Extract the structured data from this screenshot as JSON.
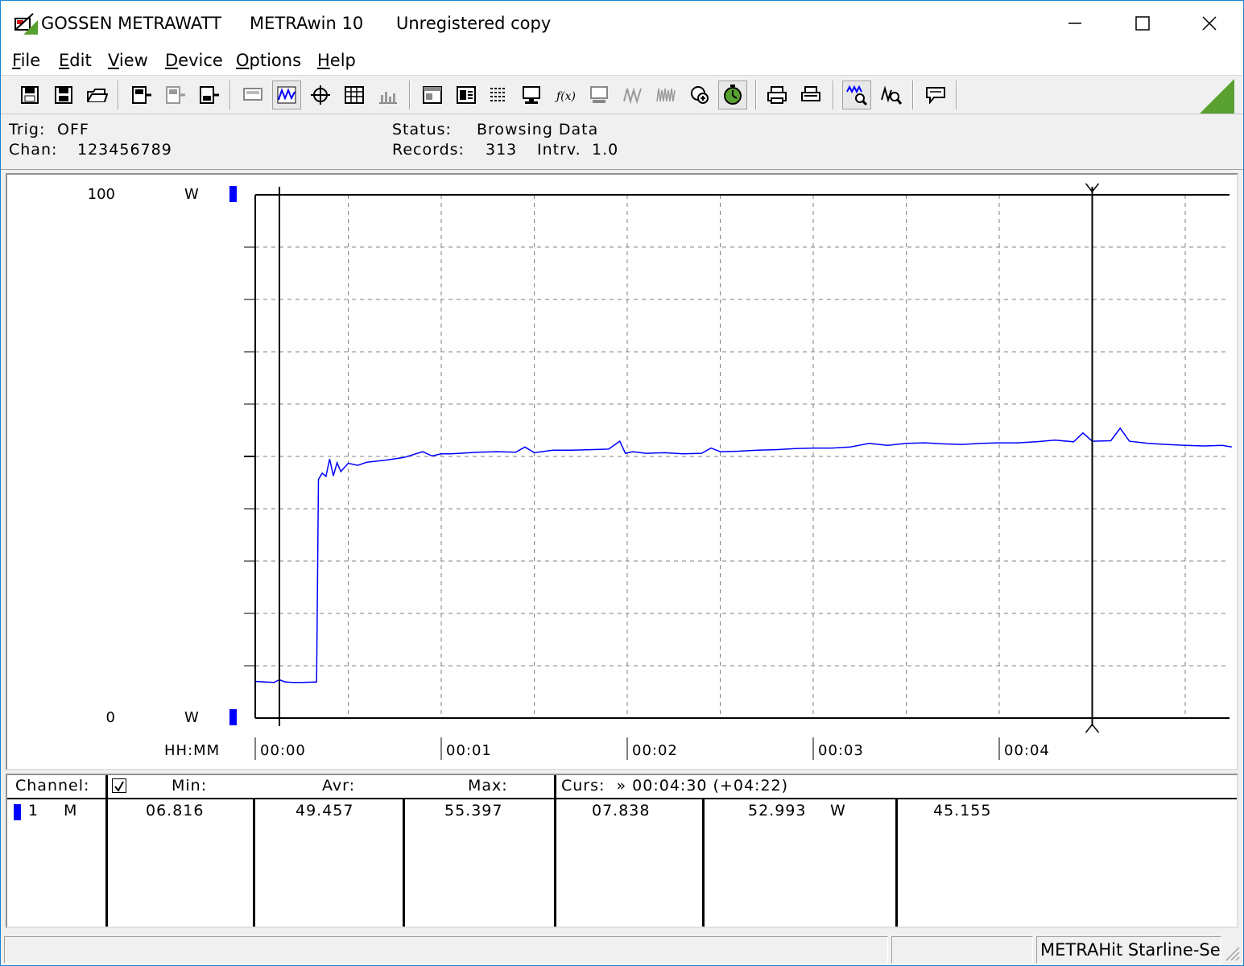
{
  "titlebar": {
    "company": "GOSSEN METRAWATT",
    "app": "METRAwin 10",
    "license": "Unregistered copy"
  },
  "menu": [
    "File",
    "Edit",
    "View",
    "Device",
    "Options",
    "Help"
  ],
  "info": {
    "trig_label": "Trig:",
    "trig_value": "OFF",
    "chan_label": "Chan:",
    "chan_value": "123456789",
    "status_label": "Status:",
    "status_value": "Browsing Data",
    "records_label": "Records:",
    "records_value": "313",
    "intrv_label": "Intrv.",
    "intrv_value": "1.0"
  },
  "chart_data": {
    "type": "line",
    "xlabel": "HH:MM",
    "x_ticks": [
      "00:00",
      "00:01",
      "00:02",
      "00:03",
      "00:04"
    ],
    "y_top_label": "100",
    "y_bottom_label": "0",
    "y_unit": "W",
    "ylim": [
      0,
      100
    ],
    "xlim_minutes": [
      0,
      5.0
    ],
    "grid": true,
    "series_color": "#0000ff",
    "cursor_minutes": [
      0.13,
      4.5
    ],
    "series": [
      {
        "x": [
          0,
          0.1,
          0.13,
          0.16,
          0.2,
          0.25,
          0.33,
          0.34,
          0.36,
          0.38,
          0.4,
          0.42,
          0.44,
          0.46,
          0.5,
          0.55,
          0.6,
          0.7,
          0.8,
          0.9,
          0.95,
          1.0,
          1.05,
          1.1,
          1.2,
          1.3,
          1.4,
          1.45,
          1.5,
          1.6,
          1.7,
          1.8,
          1.9,
          1.96,
          1.99,
          2.03,
          2.1,
          2.2,
          2.3,
          2.4,
          2.45,
          2.5,
          2.6,
          2.7,
          2.8,
          2.9,
          3.0,
          3.1,
          3.2,
          3.3,
          3.4,
          3.5,
          3.6,
          3.7,
          3.8,
          3.9,
          4.0,
          4.1,
          4.2,
          4.3,
          4.4,
          4.45,
          4.5,
          4.6,
          4.65,
          4.7,
          4.8,
          4.9,
          5.0,
          5.1,
          5.2,
          5.25
        ],
        "y": [
          7.0,
          6.8,
          7.3,
          6.9,
          6.8,
          6.8,
          6.9,
          45.6,
          46.8,
          46.2,
          49.5,
          46.3,
          48.8,
          47.1,
          48.7,
          48.3,
          48.9,
          49.3,
          49.8,
          50.9,
          50.1,
          50.5,
          50.5,
          50.6,
          50.8,
          50.9,
          50.8,
          51.8,
          50.7,
          51.2,
          51.2,
          51.3,
          51.4,
          52.9,
          50.6,
          50.9,
          50.6,
          50.7,
          50.5,
          50.6,
          51.6,
          50.9,
          51.0,
          51.2,
          51.3,
          51.5,
          51.6,
          51.6,
          51.8,
          52.5,
          52.1,
          52.5,
          52.6,
          52.4,
          52.3,
          52.5,
          52.6,
          52.6,
          52.8,
          53.1,
          52.8,
          54.5,
          52.9,
          53.0,
          55.4,
          52.9,
          52.5,
          52.3,
          52.1,
          52.0,
          52.1,
          51.8
        ]
      }
    ]
  },
  "table": {
    "headers": {
      "channel": "Channel:",
      "min": "Min:",
      "avr": "Avr:",
      "max": "Max:",
      "curs": "Curs:  » 00:04:30 (+04:22)"
    },
    "rows": [
      {
        "num": "1",
        "mode": "M",
        "min": "06.816",
        "avr": "49.457",
        "max": "55.397",
        "curs1": "07.838",
        "curs2": "52.993",
        "unit": "W",
        "diff": "45.155"
      }
    ]
  },
  "statusbar": {
    "device": "METRAHit Starline-Seri"
  },
  "colors": {
    "channel_marker": "#0000ff",
    "window_border": "#1883d7"
  }
}
